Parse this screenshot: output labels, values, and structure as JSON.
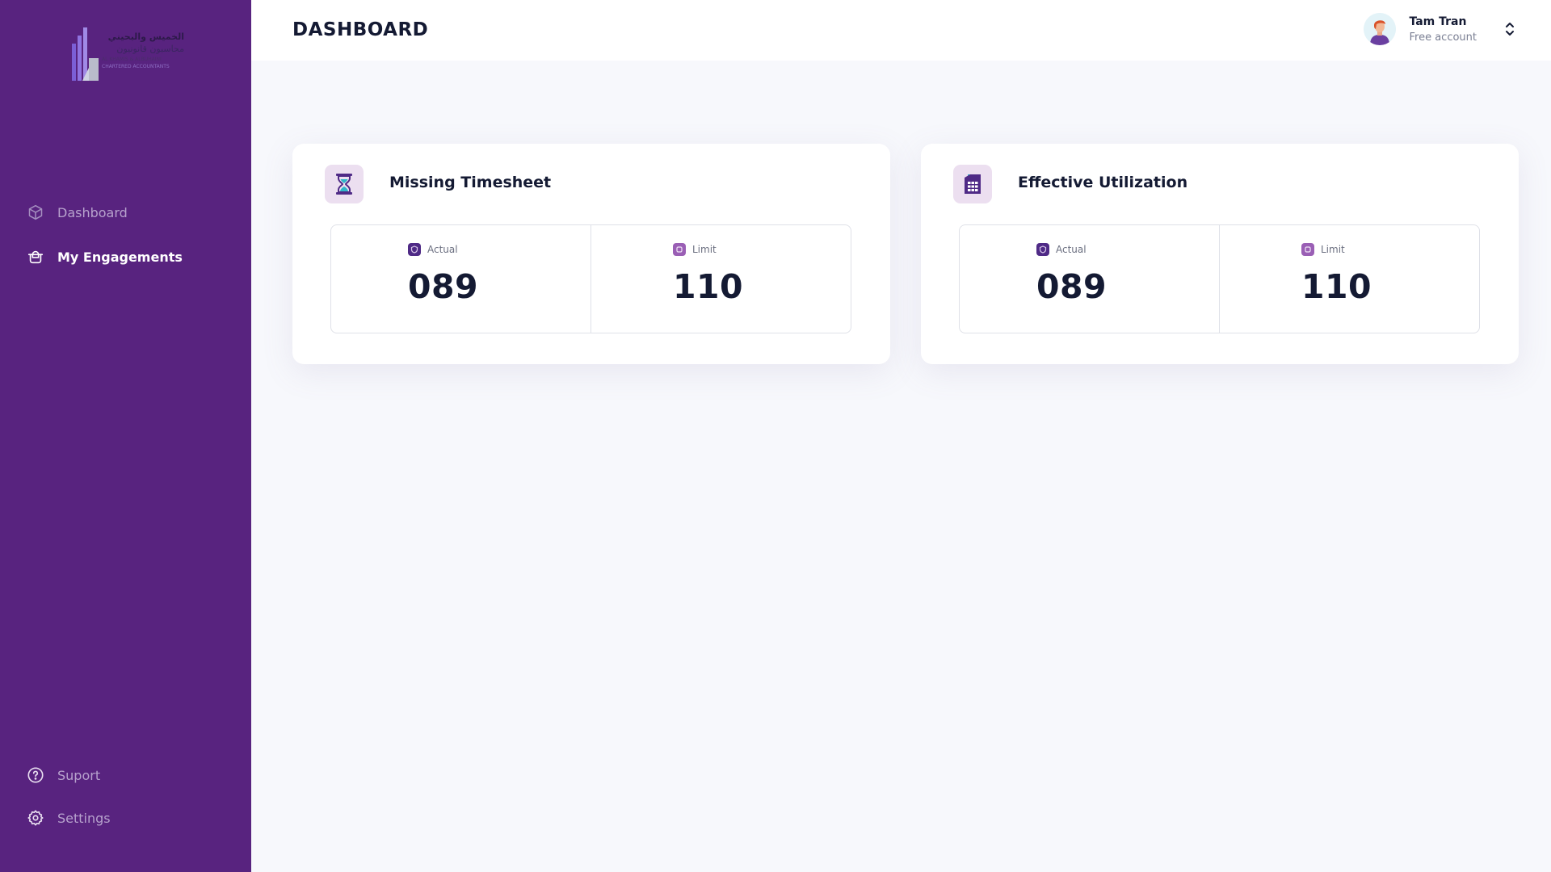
{
  "logo": {
    "arabic_line1": "الخميس والبحيني",
    "arabic_line2": "محاسبون قانونيون",
    "english_line1": "AL KHAMIS & ALBUHAINI",
    "english_line2": "CHARTERED ACCOUNTANTS"
  },
  "sidebar": {
    "items": [
      {
        "label": "Dashboard",
        "icon": "cube-icon",
        "active": false
      },
      {
        "label": "My Engagements",
        "icon": "engagements-icon",
        "active": true
      }
    ],
    "bottom_items": [
      {
        "label": "Suport",
        "icon": "help-circle-icon"
      },
      {
        "label": "Settings",
        "icon": "gear-icon"
      }
    ]
  },
  "header": {
    "title": "DASHBOARD",
    "user": {
      "name": "Tam Tran",
      "plan": "Free account"
    }
  },
  "cards": [
    {
      "title": "Missing Timesheet",
      "icon": "hourglass-icon",
      "stats": [
        {
          "label": "Actual",
          "value": "089"
        },
        {
          "label": "Limit",
          "value": "110"
        }
      ]
    },
    {
      "title": "Effective Utilization",
      "icon": "spreadsheet-icon",
      "stats": [
        {
          "label": "Actual",
          "value": "089"
        },
        {
          "label": "Limit",
          "value": "110"
        }
      ]
    }
  ],
  "colors": {
    "sidebar": "#58237f",
    "accent": "#4f2a86",
    "background": "#f7f8fc"
  }
}
